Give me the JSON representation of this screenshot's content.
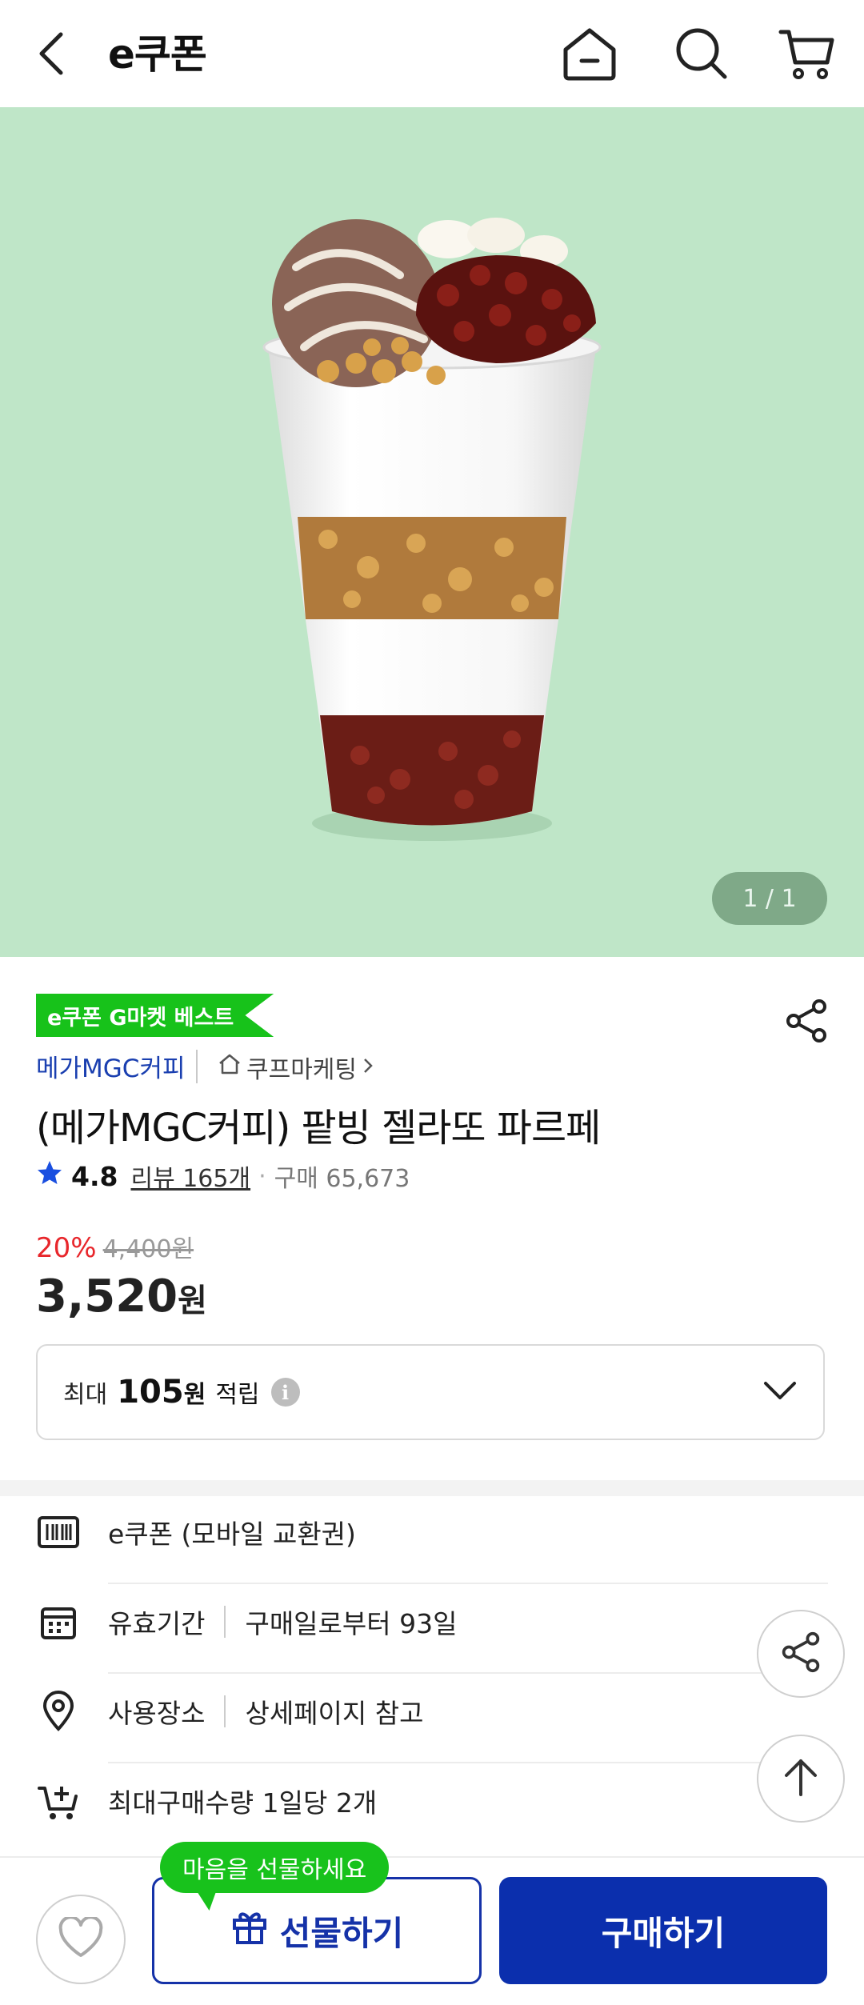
{
  "header": {
    "title": "e쿠폰"
  },
  "hero": {
    "pager": "1 / 1"
  },
  "product": {
    "badge": "e쿠폰 G마켓 베스트",
    "brand": "메가MGC커피",
    "store": "쿠프마케팅",
    "title": "(메가MGC커피) 팥빙 젤라또 파르페",
    "rating": "4.8",
    "reviews": "리뷰 165개",
    "purchase_count": "구매 65,673",
    "discount_rate": "20%",
    "original_price": "4,400원",
    "price": "3,520",
    "price_unit": "원"
  },
  "points": {
    "prefix": "최대",
    "amount": "105",
    "unit": "원",
    "suffix": "적립"
  },
  "info_rows": [
    {
      "icon": "barcode-icon",
      "label": "e쿠폰 (모바일 교환권)",
      "value": ""
    },
    {
      "icon": "calendar-icon",
      "label": "유효기간",
      "value": "구매일로부터 93일"
    },
    {
      "icon": "location-pin-icon",
      "label": "사용장소",
      "value": "상세페이지 참고"
    },
    {
      "icon": "cart-plus-icon",
      "label": "최대구매수량 1일당 2개",
      "value": ""
    }
  ],
  "bottom": {
    "tooltip": "마음을 선물하세요",
    "gift_label": "선물하기",
    "buy_label": "구매하기"
  },
  "colors": {
    "brand_blue": "#0b2fad",
    "badge_green": "#17c21a",
    "discount_red": "#e8262b",
    "hero_bg": "#bfe6c8"
  }
}
